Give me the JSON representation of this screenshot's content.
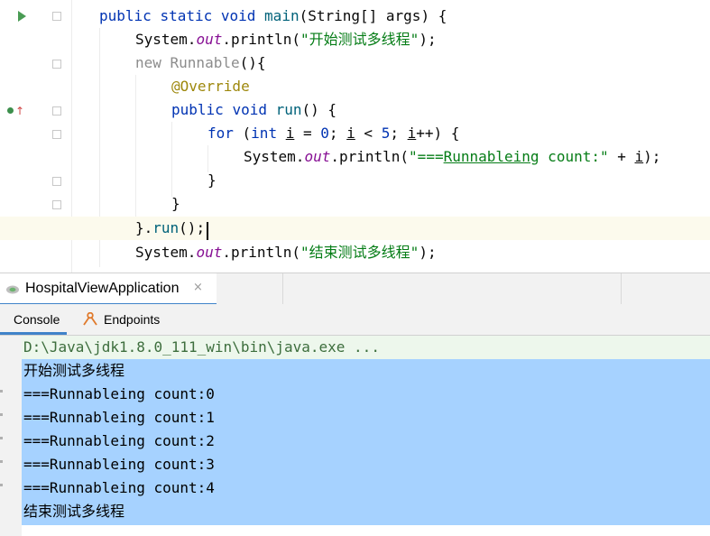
{
  "editor": {
    "lines": [
      {
        "id": "main_sig",
        "parts": [
          {
            "t": "public ",
            "c": "kw"
          },
          {
            "t": "static ",
            "c": "kw"
          },
          {
            "t": "void ",
            "c": "kw"
          },
          {
            "t": "main",
            "c": "fn"
          },
          {
            "t": "(String[] args) {",
            "c": ""
          }
        ]
      },
      {
        "id": "println_start",
        "parts": [
          {
            "t": "System.",
            "c": ""
          },
          {
            "t": "out",
            "c": "it"
          },
          {
            "t": ".println(",
            "c": ""
          },
          {
            "t": "\"开始测试多线程\"",
            "c": "st"
          },
          {
            "t": ");",
            "c": ""
          }
        ]
      },
      {
        "id": "new_runnable",
        "parts": [
          {
            "t": "new ",
            "c": "gy"
          },
          {
            "t": "Runnable",
            "c": "gy"
          },
          {
            "t": "(){",
            "c": ""
          }
        ]
      },
      {
        "id": "override",
        "parts": [
          {
            "t": "@Override",
            "c": "an"
          }
        ]
      },
      {
        "id": "run_sig",
        "parts": [
          {
            "t": "public ",
            "c": "kw"
          },
          {
            "t": "void ",
            "c": "kw"
          },
          {
            "t": "run",
            "c": "fn"
          },
          {
            "t": "() {",
            "c": ""
          }
        ]
      },
      {
        "id": "for_loop",
        "parts": [
          {
            "t": "for ",
            "c": "kw"
          },
          {
            "t": "(",
            "c": ""
          },
          {
            "t": "int ",
            "c": "kw"
          },
          {
            "t": "i",
            "c": "ul"
          },
          {
            "t": " = ",
            "c": ""
          },
          {
            "t": "0",
            "c": "kw"
          },
          {
            "t": "; ",
            "c": ""
          },
          {
            "t": "i",
            "c": "ul"
          },
          {
            "t": " < ",
            "c": ""
          },
          {
            "t": "5",
            "c": "kw"
          },
          {
            "t": "; ",
            "c": ""
          },
          {
            "t": "i",
            "c": "ul"
          },
          {
            "t": "++) {",
            "c": ""
          }
        ]
      },
      {
        "id": "println_count",
        "parts": [
          {
            "t": "System.",
            "c": ""
          },
          {
            "t": "out",
            "c": "it"
          },
          {
            "t": ".println(",
            "c": ""
          },
          {
            "t": "\"===",
            "c": "st"
          },
          {
            "t": "Runnableing",
            "c": "st ulg"
          },
          {
            "t": " count:\"",
            "c": "st"
          },
          {
            "t": " + ",
            "c": ""
          },
          {
            "t": "i",
            "c": "ul"
          },
          {
            "t": ");",
            "c": ""
          }
        ]
      },
      {
        "id": "close_for",
        "parts": [
          {
            "t": "}",
            "c": ""
          }
        ]
      },
      {
        "id": "close_run",
        "parts": [
          {
            "t": "}",
            "c": ""
          }
        ]
      },
      {
        "id": "run_call",
        "parts": [
          {
            "t": "}.",
            "c": ""
          },
          {
            "t": "run",
            "c": "fn"
          },
          {
            "t": "();",
            "c": ""
          }
        ]
      },
      {
        "id": "println_end",
        "parts": [
          {
            "t": "System.",
            "c": ""
          },
          {
            "t": "out",
            "c": "it"
          },
          {
            "t": ".println(",
            "c": ""
          },
          {
            "t": "\"结束测试多线程\"",
            "c": "st"
          },
          {
            "t": ");",
            "c": ""
          }
        ]
      }
    ]
  },
  "run_panel": {
    "tab_label": "HospitalViewApplication",
    "tab_close": "×",
    "subtabs": {
      "console": "Console",
      "endpoints": "Endpoints"
    },
    "console_lines": [
      "D:\\Java\\jdk1.8.0_111_win\\bin\\java.exe ...",
      "开始测试多线程",
      "===Runnableing count:0",
      "===Runnableing count:1",
      "===Runnableing count:2",
      "===Runnableing count:3",
      "===Runnableing count:4",
      "结束测试多线程"
    ]
  },
  "icons": {
    "run_gutter": "run-arrow-icon",
    "override_gutter": "override-method-icon",
    "app_tab": "spring-boot-app-icon",
    "endpoints": "endpoints-icon"
  },
  "colors": {
    "keyword": "#0033b3",
    "method": "#00627a",
    "string": "#067d17",
    "static_field": "#871094",
    "annotation": "#9e880d",
    "selection": "#a6d2ff",
    "accent_tab": "#4083c9"
  }
}
